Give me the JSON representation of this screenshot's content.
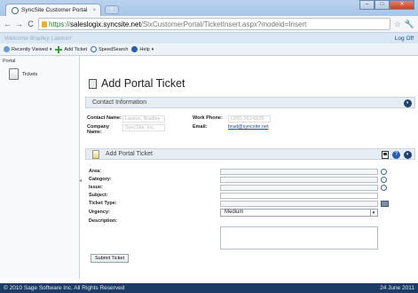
{
  "browser": {
    "tab_title": "SyncSite Customer Portal",
    "tab_close": "×",
    "new_tab": "+",
    "win_min": "–",
    "win_max": "□",
    "win_close": "✕",
    "back": "←",
    "forward": "→",
    "reload": "C",
    "url_scheme": "https://",
    "url_host": "saleslogix.syncsite.net",
    "url_path": "/SlxCustomerPortal/TicketInsert.aspx?modeid=Insert"
  },
  "header": {
    "welcome": "Welcome Bradley Lawton!",
    "logoff": "Log Off"
  },
  "toolbar": {
    "recently_viewed": "Recently Viewed",
    "add_ticket": "Add Ticket",
    "speedsearch": "SpeedSearch",
    "help": "Help",
    "caret": "▾"
  },
  "sidebar": {
    "title": "Portal",
    "items": [
      {
        "label": "Tickets"
      }
    ]
  },
  "page": {
    "title": "Add Portal Ticket"
  },
  "contact_panel": {
    "title": "Contact Information",
    "toggle": "◐",
    "contact_name_label": "Contact Name:",
    "contact_name_value": "Lawton, Bradley",
    "company_name_label": "Company Name:",
    "company_name_value": "SyncSite, Inc.",
    "work_phone_label": "Work Phone:",
    "work_phone_value": "(205) 263-6635",
    "email_label": "Email:",
    "email_value": "brad@syncsite.net"
  },
  "ticket_form": {
    "title": "Add Portal Ticket",
    "help": "?",
    "close": "◐",
    "fields": {
      "area": "Area:",
      "category": "Category:",
      "issue": "Issue:",
      "subject": "Subject:",
      "ticket_type": "Ticket Type:",
      "urgency": "Urgency:",
      "description": "Description:"
    },
    "urgency_value": "Medium",
    "urgency_arrow": "▼",
    "pick_button": "...",
    "submit": "Submit Ticket"
  },
  "footer": {
    "copyright": "© 2010 Sage Software Inc. All Rights Reserved",
    "date": "24 June 2011"
  }
}
